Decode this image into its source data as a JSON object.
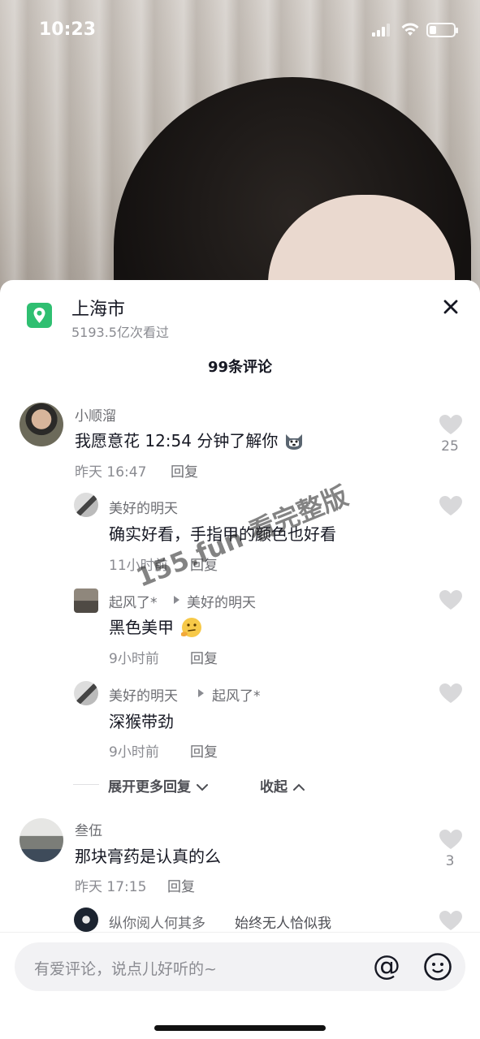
{
  "status_bar": {
    "time": "10:23",
    "battery_level": 0.3
  },
  "location": {
    "title": "上海市",
    "views": "5193.5亿次看过"
  },
  "comments_header": "99条评论",
  "comments": [
    {
      "user": "小顺溜",
      "text": "我愿意花 12:54 分钟了解你",
      "emoji": "husky-emoji",
      "time": "昨天 16:47",
      "reply_label": "回复",
      "likes": "25",
      "replies": [
        {
          "user": "美好的明天",
          "text": "确实好看，手指甲的颜色也好看",
          "time": "11小时前",
          "reply_label": "回复"
        },
        {
          "user": "起风了*",
          "reply_to": "美好的明天",
          "text": "黑色美甲",
          "emoji": "thinking-face-emoji",
          "time": "9小时前",
          "reply_label": "回复"
        },
        {
          "user": "美好的明天",
          "reply_to": "起风了*",
          "text": "深猴带劲",
          "time": "9小时前",
          "reply_label": "回复"
        }
      ],
      "expand_label": "展开更多回复",
      "collapse_label": "收起"
    },
    {
      "user": "叁伍",
      "text": "那块膏药是认真的么",
      "time": "昨天 17:15",
      "reply_label": "回复",
      "likes": "3",
      "replies": [
        {
          "user": "纵你阅人何其多",
          "text": "始终无人恰似我"
        }
      ]
    }
  ],
  "watermark": "155.fun 看完整版",
  "input": {
    "placeholder": "有爱评论，说点儿好听的~"
  },
  "icons": {
    "location": "location-pin-icon",
    "close": "close-icon",
    "like": "heart-icon",
    "mention": "at-icon",
    "emoji": "smiley-icon"
  },
  "colors": {
    "location_icon_bg": "#2fbf71",
    "text_primary": "#161823",
    "text_secondary": "#8a8b91"
  }
}
